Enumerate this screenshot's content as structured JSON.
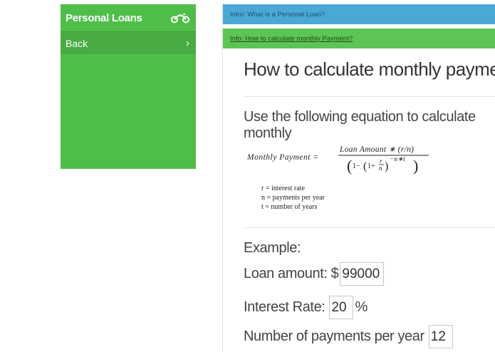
{
  "sidebar": {
    "title": "Personal Loans",
    "title_icon": "motorcycle-icon",
    "back_label": "Back",
    "back_icon": "chevron-right-icon"
  },
  "tabs": {
    "intro_label": "Intro: What is a Personal Loan?",
    "info_label": "Info: How to calculate monthly Payment?"
  },
  "content": {
    "title": "How to calculate monthly payment?",
    "lead": "Use the following equation to calculate monthly",
    "formula": {
      "lhs": "Monthly Payment =",
      "numerator": "Loan Amount ∗ (r/n)",
      "one": "1−",
      "inner_one": "1+",
      "r": "r",
      "n": "n",
      "exponent": "−n∗t"
    },
    "variables": [
      "r = interest rate",
      "n = payments per year",
      "t = number of years"
    ],
    "example_heading": "Example:",
    "loan_label": "Loan amount: $",
    "loan_value": "99000",
    "rate_label": "Interest Rate:",
    "rate_value": "20",
    "rate_unit": "%",
    "payments_label": "Number of payments per year",
    "payments_value": "12"
  },
  "colors": {
    "sidebar_green": "#4fbe49",
    "intro_blue": "#4aa8d6",
    "info_green": "#5dc553"
  }
}
